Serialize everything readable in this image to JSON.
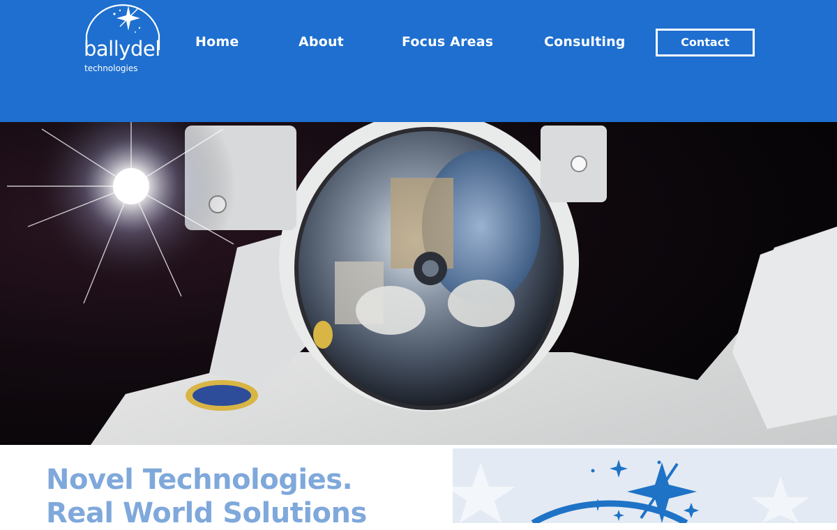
{
  "brand": {
    "name": "ballydel",
    "subtitle": "technologies"
  },
  "nav": {
    "items": [
      {
        "label": "Home"
      },
      {
        "label": "About"
      },
      {
        "label": "Focus Areas"
      },
      {
        "label": "Consulting"
      }
    ],
    "contact_label": "Contact"
  },
  "hero": {
    "image_subject": "astronaut-selfie-in-space"
  },
  "intro": {
    "line1": "Novel Technologies.",
    "line2": "Real World Solutions"
  },
  "colors": {
    "header_bg": "#1e6fcf",
    "nav_text": "#ffffff",
    "tagline": "#7fa8db",
    "logo_arc": "#1e73c6"
  }
}
